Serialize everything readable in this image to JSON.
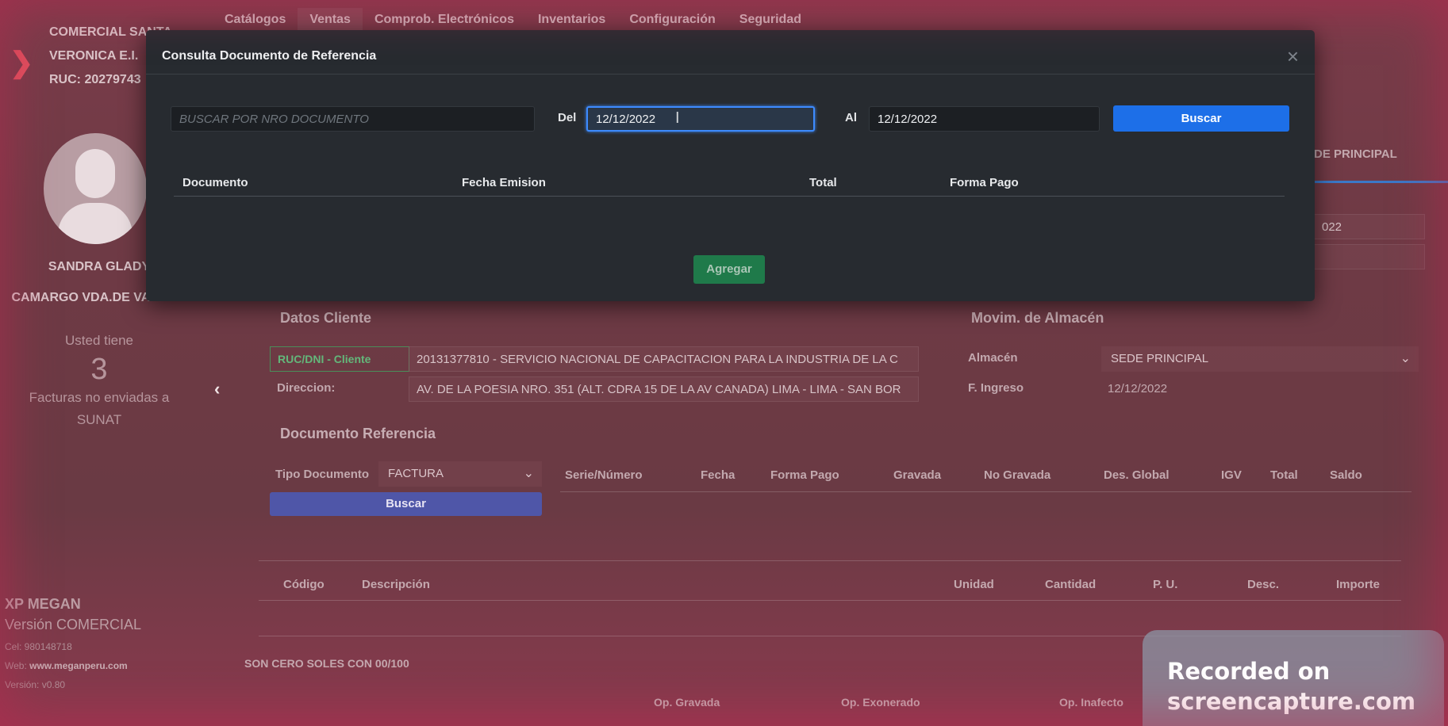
{
  "nav": {
    "items": [
      {
        "label": "Catálogos"
      },
      {
        "label": "Ventas"
      },
      {
        "label": "Comprob. Electrónicos"
      },
      {
        "label": "Inventarios"
      },
      {
        "label": "Configuración"
      },
      {
        "label": "Seguridad"
      }
    ]
  },
  "sidebar": {
    "company_line1": "COMERCIAL SANTA",
    "company_line2": "VERONICA E.I.",
    "ruc": "RUC: 20279743",
    "user_line1": "SANDRA GLADY",
    "user_line2": "CAMARGO VDA.DE VARGAS",
    "pending_pre": "Usted tiene",
    "pending_count": "3",
    "pending_post1": "Facturas no enviadas a",
    "pending_post2": "SUNAT",
    "app_name": "XP MEGAN",
    "app_version_label": "Versión COMERCIAL",
    "cel": "Cel: 980148718",
    "web_label": "Web:",
    "web_url": "www.meganperu.com",
    "version": "Versión: v0.80"
  },
  "background_form": {
    "sede_tab": "DE PRINCIPAL",
    "date_partial": "022",
    "datos_cliente_title": "Datos Cliente",
    "ruc_label": "RUC/DNI - Cliente",
    "ruc_value": "20131377810 - SERVICIO NACIONAL DE CAPACITACION PARA LA INDUSTRIA DE LA C",
    "direccion_label": "Direccion:",
    "direccion_value": "AV. DE LA POESIA NRO. 351 (ALT. CDRA 15 DE LA AV CANADA) LIMA - LIMA - SAN BOR",
    "movim_title": "Movim. de Almacén",
    "almacen_label": "Almacén",
    "almacen_value": "SEDE PRINCIPAL",
    "ingreso_label": "F. Ingreso",
    "ingreso_value": "12/12/2022",
    "doc_ref_title": "Documento Referencia",
    "tipo_doc_label": "Tipo Documento",
    "tipo_doc_value": "FACTURA",
    "buscar_label": "Buscar",
    "ref_columns": [
      "Serie/Número",
      "Fecha",
      "Forma Pago",
      "Gravada",
      "No Gravada",
      "Des. Global",
      "IGV",
      "Total",
      "Saldo"
    ],
    "item_columns": [
      "Código",
      "Descripción",
      "Unidad",
      "Cantidad",
      "P. U.",
      "Desc.",
      "Importe"
    ],
    "amount_words": "SON CERO SOLES CON 00/100",
    "totals_labels": [
      "Op. Gravada",
      "Op. Exonerado",
      "Op. Inafecto"
    ]
  },
  "modal": {
    "title": "Consulta Documento de Referencia",
    "close": "×",
    "search_placeholder": "BUSCAR POR NRO DOCUMENTO",
    "del_label": "Del",
    "del_value": "12/12/2022",
    "al_label": "Al",
    "al_value": "12/12/2022",
    "buscar_label": "Buscar",
    "columns": [
      "Documento",
      "Fecha Emision",
      "Total",
      "Forma Pago"
    ],
    "agregar_label": "Agregar"
  },
  "watermark": {
    "line1": "Recorded on",
    "line2": "screencapture.com"
  },
  "colors": {
    "accent_blue": "#1d6fe8",
    "modal_bg": "#272b30",
    "agregar_green": "#1f7a4a",
    "chevron_red": "#e0505e"
  }
}
